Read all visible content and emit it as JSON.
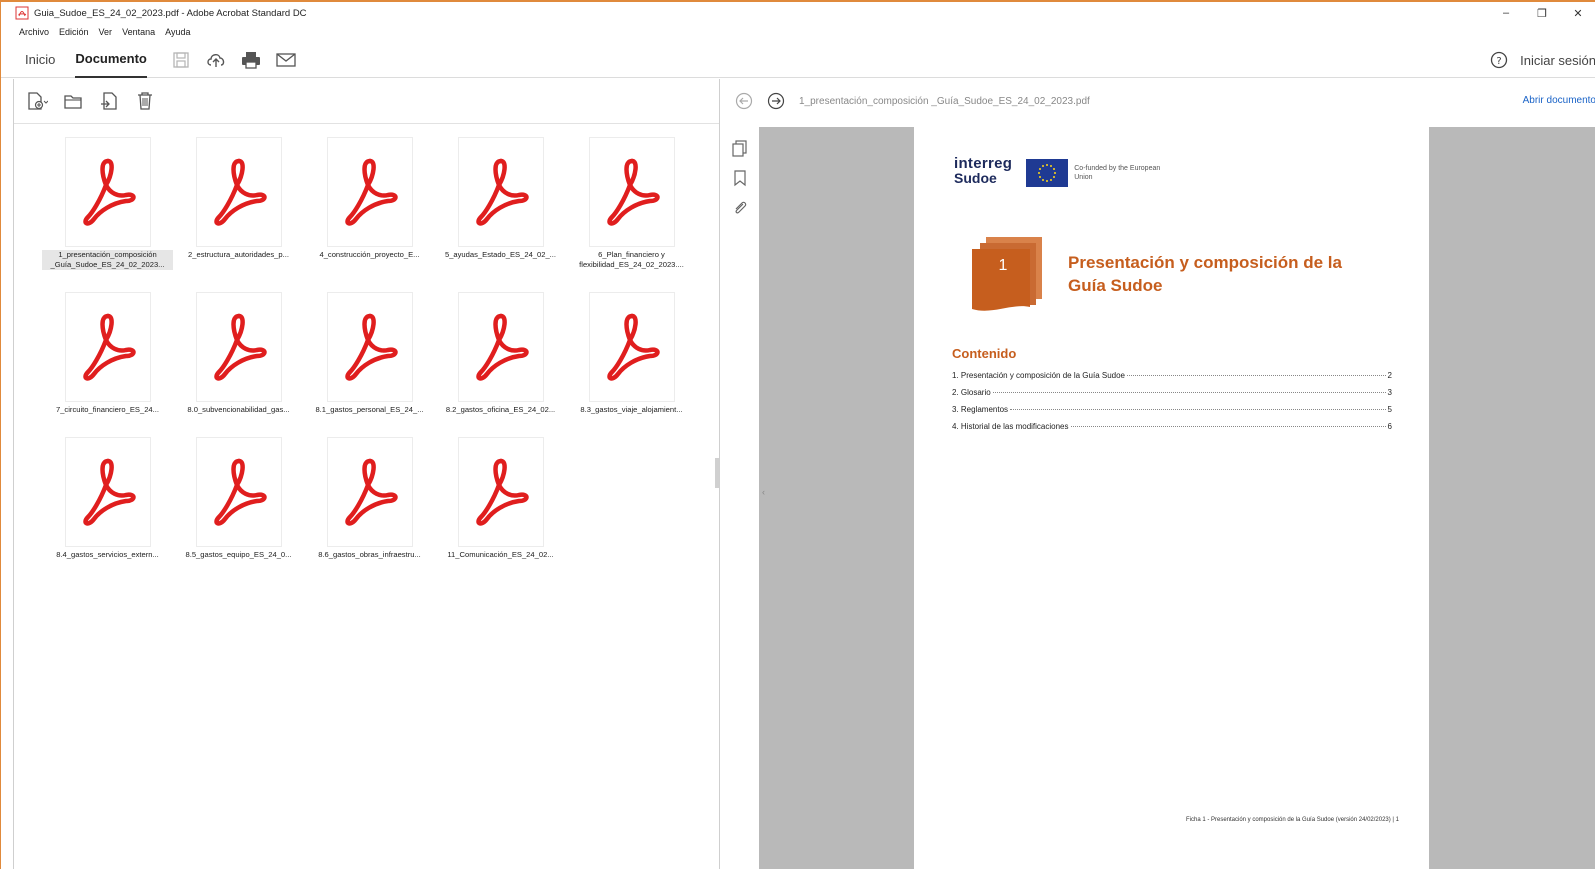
{
  "window": {
    "title": "Guia_Sudoe_ES_24_02_2023.pdf - Adobe Acrobat Standard DC",
    "minimize": "–",
    "restore": "❐",
    "close": "✕"
  },
  "menu": [
    "Archivo",
    "Edición",
    "Ver",
    "Ventana",
    "Ayuda"
  ],
  "toolbar": {
    "tab_home": "Inicio",
    "tab_document": "Documento",
    "signin": "Iniciar sesión"
  },
  "files": [
    {
      "name": "1_presentación_composición\n_Guía_Sudoe_ES_24_02_2023...",
      "selected": true
    },
    {
      "name": "2_estructura_autoridades_p...",
      "selected": false
    },
    {
      "name": "4_construcción_proyecto_E...",
      "selected": false
    },
    {
      "name": "5_ayudas_Estado_ES_24_02_...",
      "selected": false
    },
    {
      "name": "6_Plan_financiero y\nflexibilidad_ES_24_02_2023....",
      "selected": false
    },
    {
      "name": "7_circuito_financiero_ES_24...",
      "selected": false
    },
    {
      "name": "8.0_subvencionabilidad_gas...",
      "selected": false
    },
    {
      "name": "8.1_gastos_personal_ES_24_...",
      "selected": false
    },
    {
      "name": "8.2_gastos_oficina_ES_24_02...",
      "selected": false
    },
    {
      "name": "8.3_gastos_viaje_alojamient...",
      "selected": false
    },
    {
      "name": "8.4_gastos_servicios_extern...",
      "selected": false
    },
    {
      "name": "8.5_gastos_equipo_ES_24_0...",
      "selected": false
    },
    {
      "name": "8.6_gastos_obras_infraestru...",
      "selected": false
    },
    {
      "name": "11_Comunicación_ES_24_02...",
      "selected": false
    }
  ],
  "preview": {
    "filename": "1_presentación_composición _Guía_Sudoe_ES_24_02_2023.pdf",
    "open_document": "Abrir documento",
    "logo_line1": "interreg",
    "logo_line2": "Sudoe",
    "eu_text": "Co-funded by the European Union",
    "chapter_number": "1",
    "title": "Presentación y composición de la Guía Sudoe",
    "contents_heading": "Contenido",
    "toc": [
      {
        "label": "1. Presentación y composición de la Guía Sudoe",
        "page": "2"
      },
      {
        "label": "2. Glosario",
        "page": "3"
      },
      {
        "label": "3. Reglamentos",
        "page": "5"
      },
      {
        "label": "4. Historial de las modificaciones",
        "page": "6"
      }
    ],
    "footer": "Ficha 1 - Presentación y composición de la Guía Sudoe (versión 24/02/2023) | 1"
  },
  "colors": {
    "accent_orange": "#c65e1e",
    "acrobat_red": "#e01e1e",
    "link_blue": "#1a63c7"
  }
}
